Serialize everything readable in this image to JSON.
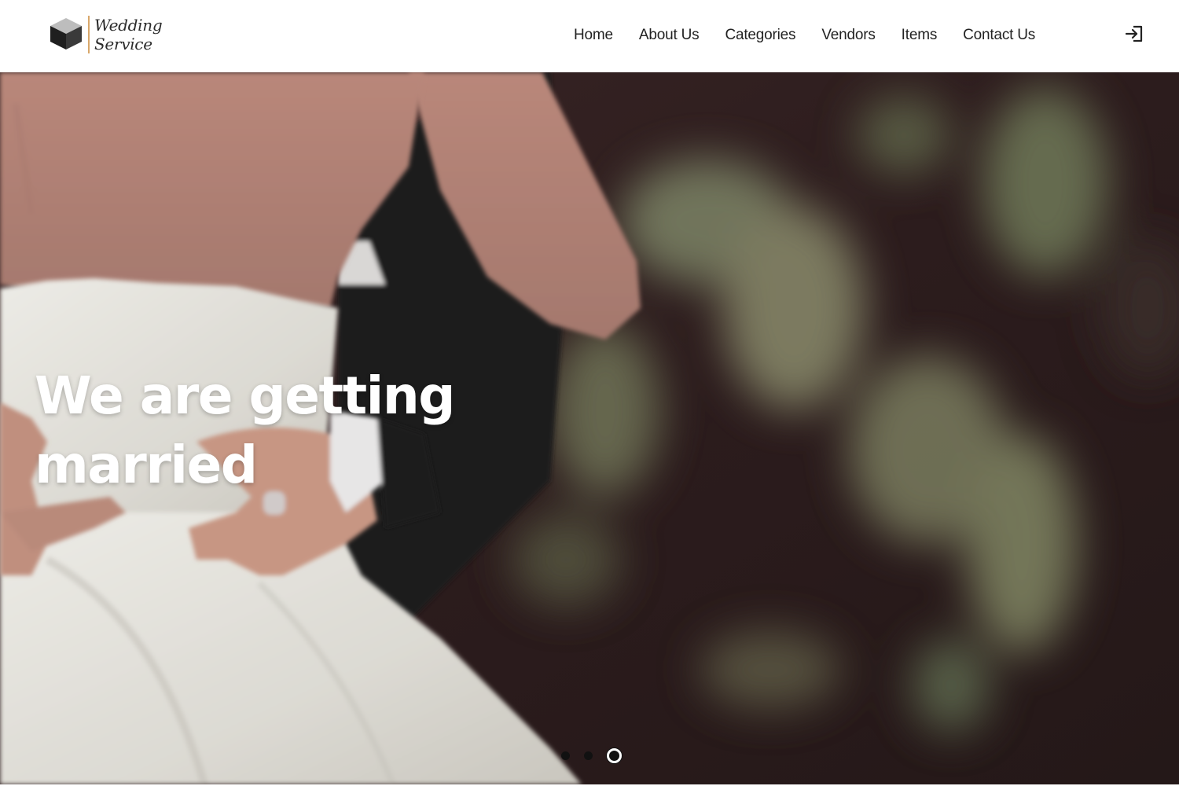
{
  "brand": {
    "line1": "Wedding",
    "line2": "Service",
    "accent_color": "#d9a86a"
  },
  "nav": {
    "items": [
      {
        "label": "Home"
      },
      {
        "label": "About Us"
      },
      {
        "label": "Categories"
      },
      {
        "label": "Vendors"
      },
      {
        "label": "Items"
      },
      {
        "label": "Contact Us"
      }
    ],
    "login_icon": "sign-in-icon"
  },
  "hero": {
    "title": "We are getting married",
    "image": "bride-and-groom-embrace-photo",
    "slides": 3,
    "active_slide": 3
  },
  "colors": {
    "hero_dark": "#2f1e1f",
    "text_dark": "#222222",
    "title_white": "#ffffff"
  }
}
